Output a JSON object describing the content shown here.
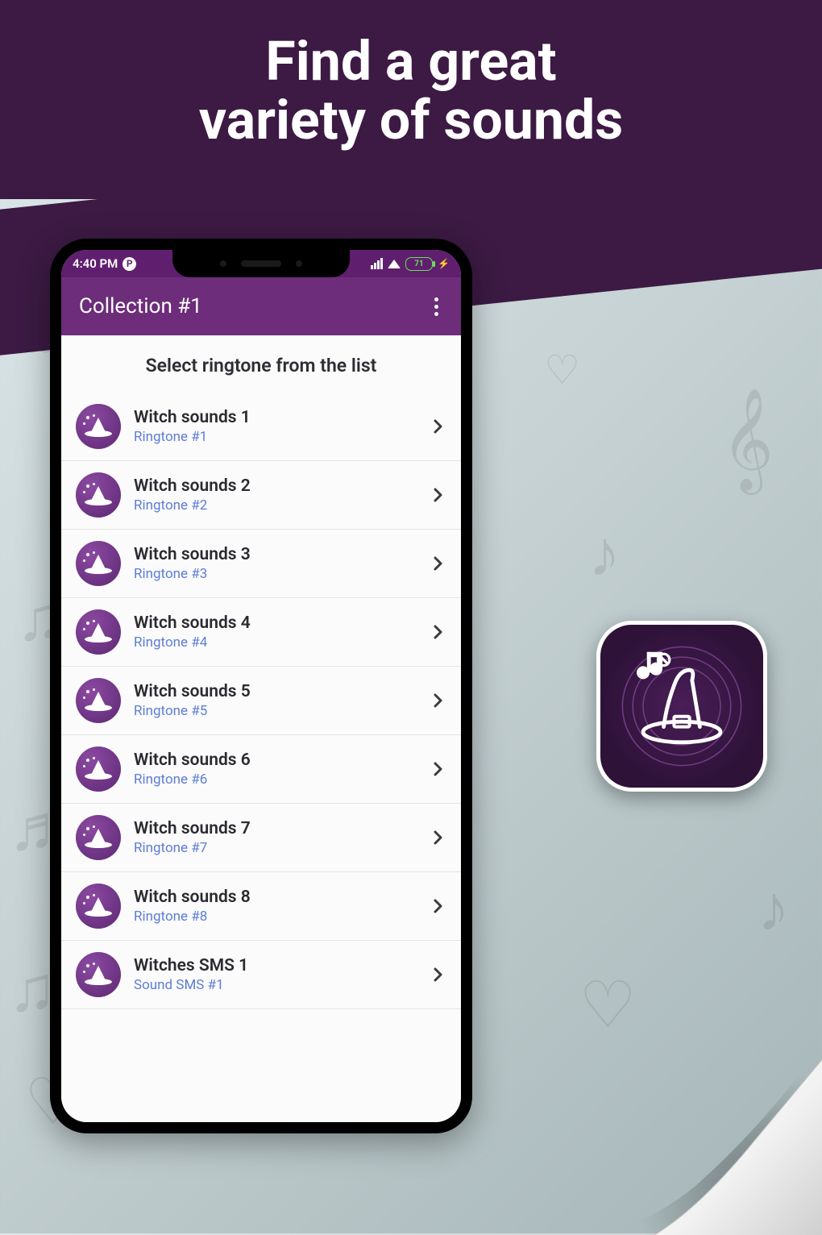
{
  "banner": {
    "line1": "Find a great",
    "line2": "variety of sounds"
  },
  "status": {
    "time": "4:40 PM",
    "battery": "71"
  },
  "appbar": {
    "title": "Collection #1"
  },
  "list": {
    "header": "Select ringtone from the list",
    "items": [
      {
        "title": "Witch sounds 1",
        "subtitle": "Ringtone #1"
      },
      {
        "title": "Witch sounds 2",
        "subtitle": "Ringtone #2"
      },
      {
        "title": "Witch sounds 3",
        "subtitle": "Ringtone #3"
      },
      {
        "title": "Witch sounds 4",
        "subtitle": "Ringtone #4"
      },
      {
        "title": "Witch sounds 5",
        "subtitle": "Ringtone #5"
      },
      {
        "title": "Witch sounds 6",
        "subtitle": "Ringtone #6"
      },
      {
        "title": "Witch sounds 7",
        "subtitle": "Ringtone #7"
      },
      {
        "title": "Witch sounds 8",
        "subtitle": "Ringtone #8"
      },
      {
        "title": "Witches SMS 1",
        "subtitle": "Sound SMS #1"
      }
    ]
  },
  "colors": {
    "bannerBg": "#3c1a43",
    "appbarBg": "#6d2d7a",
    "statusBg": "#5f1f6e",
    "iconBg": "#5e2874",
    "subtitle": "#5e7dd6"
  }
}
